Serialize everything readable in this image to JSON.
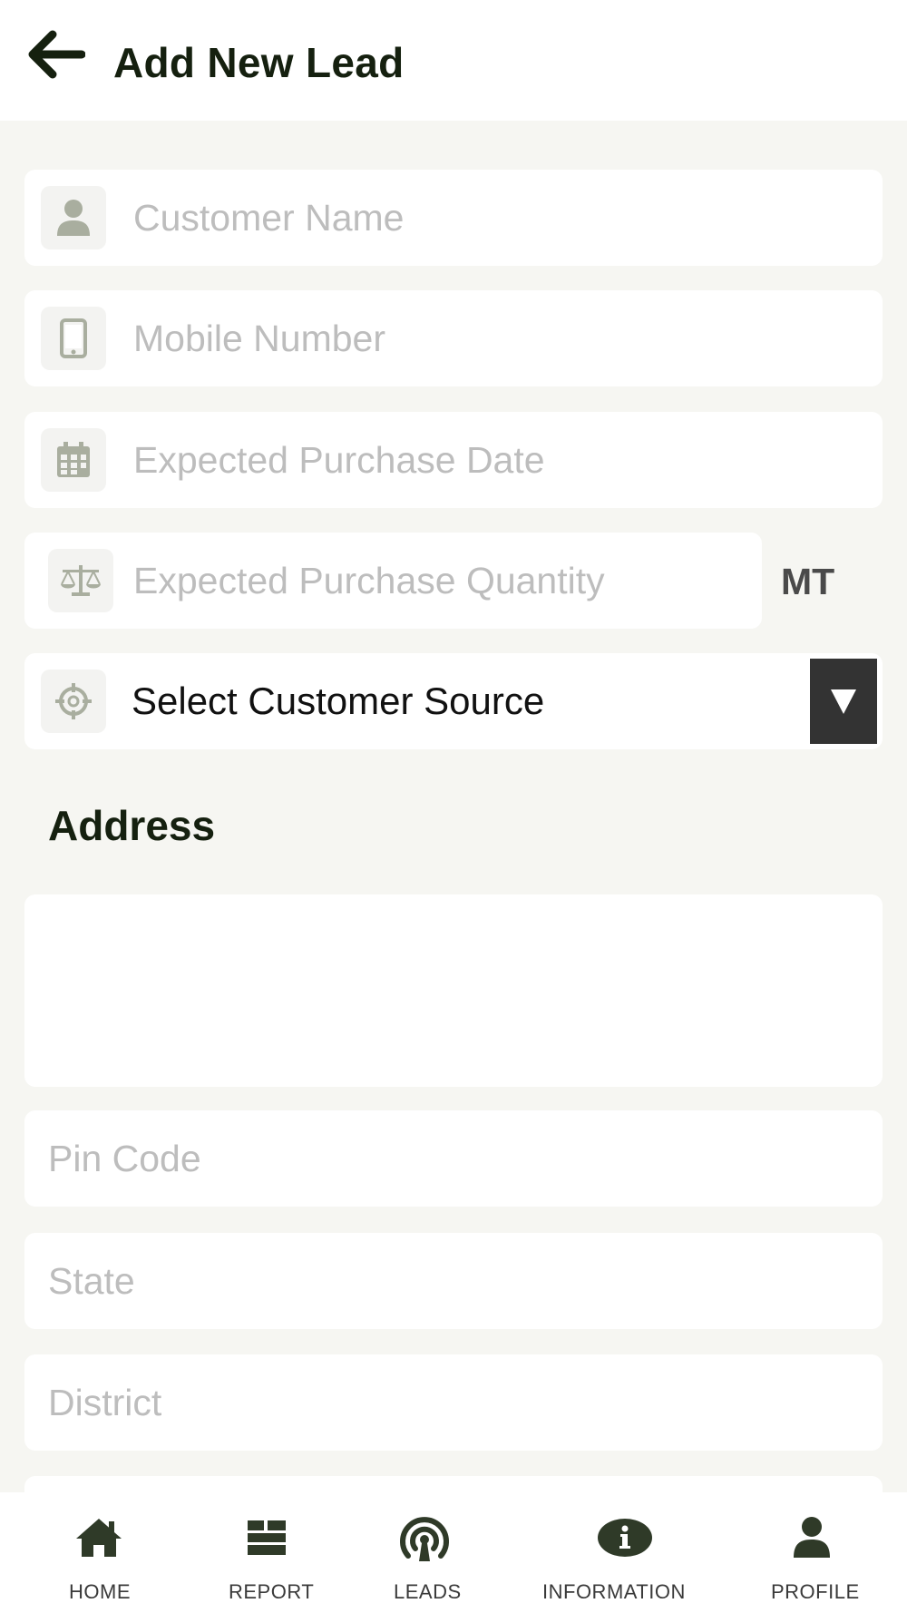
{
  "header": {
    "title": "Add New Lead"
  },
  "form": {
    "customer_name": {
      "placeholder": "Customer Name",
      "value": ""
    },
    "mobile_number": {
      "placeholder": "Mobile Number",
      "value": ""
    },
    "purchase_date": {
      "placeholder": "Expected Purchase Date",
      "value": ""
    },
    "purchase_quantity": {
      "placeholder": "Expected Purchase Quantity",
      "value": "",
      "unit": "MT"
    },
    "customer_source": {
      "selected": "Select Customer Source"
    },
    "address_label": "Address",
    "address": {
      "value": ""
    },
    "pin_code": {
      "placeholder": "Pin Code",
      "value": ""
    },
    "state": {
      "placeholder": "State",
      "value": ""
    },
    "district": {
      "placeholder": "District",
      "value": ""
    }
  },
  "nav": {
    "home": "HOME",
    "report": "REPORT",
    "leads": "LEADS",
    "information": "INFORMATION",
    "profile": "PROFILE"
  },
  "colors": {
    "background": "#f6f6f2",
    "title": "#15200f",
    "icon": "#a9ae9f",
    "nav_icon": "#2f3a28",
    "dropdown": "#333333",
    "placeholder": "#bdbdbd"
  }
}
